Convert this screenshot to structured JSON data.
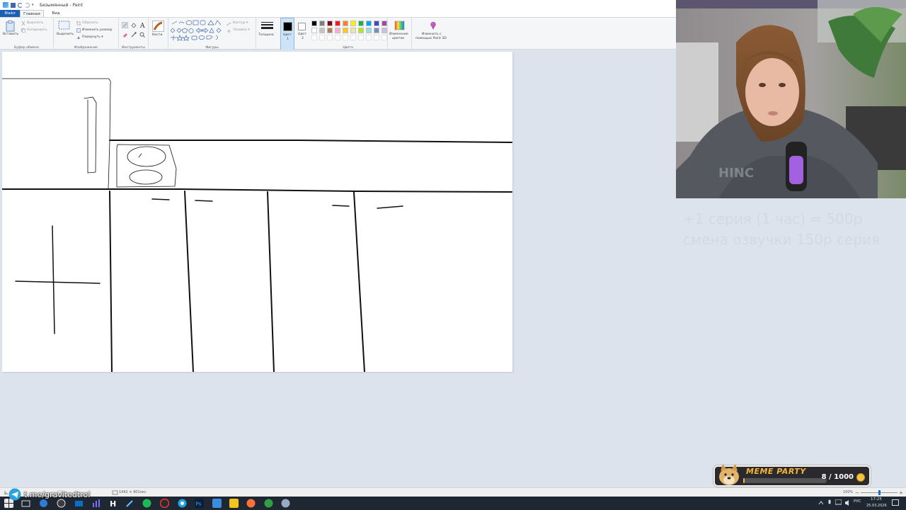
{
  "window": {
    "title": "Безымянный - Paint"
  },
  "menu": {
    "file": "Файл",
    "tabs": [
      "Главная",
      "Вид"
    ]
  },
  "ribbon": {
    "clipboard": {
      "label": "Буфер обмена",
      "paste": "Вставить",
      "cut": "Вырезать",
      "copy": "Копировать"
    },
    "image": {
      "label": "Изображение",
      "select": "Выделить",
      "crop": "Обрезать",
      "resize": "Изменить размер",
      "rotate": "Повернуть ▾"
    },
    "tools": {
      "label": "Инструменты"
    },
    "brushes": {
      "label": "Кисти"
    },
    "shapes": {
      "label": "Фигуры",
      "outline": "Контур ▾",
      "fill": "Заливка ▾"
    },
    "size": {
      "label": "Толщина"
    },
    "color1": {
      "label": "Цвет",
      "sub": "1"
    },
    "color2": {
      "label": "Цвет",
      "sub": "2"
    },
    "colors": {
      "label": "Цвета"
    },
    "edit_colors": {
      "line1": "Изменение",
      "line2": "цветов"
    },
    "paint3d": {
      "line1": "Изменить с",
      "line2": "помощью Paint 3D"
    },
    "palette_row1": [
      "#000000",
      "#7f7f7f",
      "#880015",
      "#ed1c24",
      "#ff7f27",
      "#fff200",
      "#22b14c",
      "#00a2e8",
      "#3f48cc",
      "#a349a4"
    ],
    "palette_row2": [
      "#ffffff",
      "#c3c3c3",
      "#b97a57",
      "#ffaec9",
      "#ffc90e",
      "#efe4b0",
      "#b5e61d",
      "#99d9ea",
      "#7092be",
      "#c8bfe7"
    ]
  },
  "status": {
    "canvas_size": "1442 × 901пкс",
    "zoom": "100%"
  },
  "overlay": {
    "line1": "+1 серия (1 час) = 500р",
    "line2": "смена озвучки 150р серия"
  },
  "meme_party": {
    "name": "MEME PARTY",
    "count": "8 / 1000"
  },
  "taskbar": {
    "watermark": "t.me/gravitedtrol",
    "lang": "РУС",
    "time": "17:25",
    "date": "25.03.2026"
  }
}
